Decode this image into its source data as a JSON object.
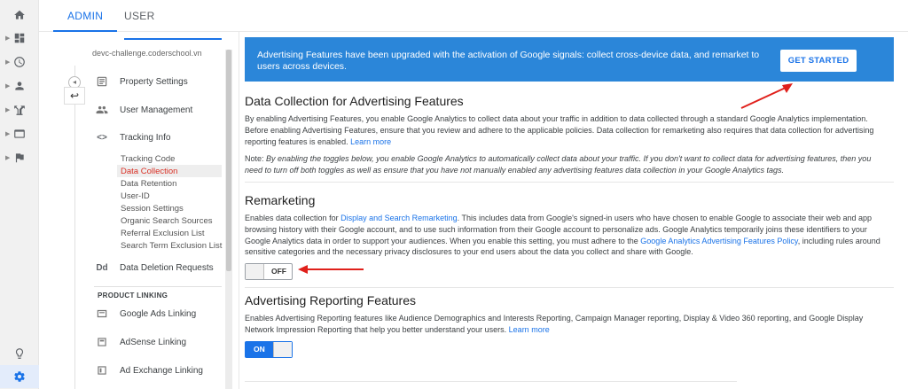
{
  "tabs": {
    "admin": "ADMIN",
    "user": "USER"
  },
  "rail": {
    "items": [
      "home-icon",
      "dashboard-icon",
      "clock-icon",
      "person-icon",
      "acquisition-icon",
      "behavior-icon",
      "flag-icon"
    ],
    "bottom": [
      "lightbulb-icon",
      "gear-icon"
    ]
  },
  "admin": {
    "property": "devc-challenge.coderschool.vn",
    "back_glyph": "↩",
    "collapse_glyph": "◂",
    "nav": {
      "property_settings": "Property Settings",
      "user_management": "User Management",
      "tracking_info": "Tracking Info",
      "tracking_icon_text": "<>",
      "data_deletion": "Data Deletion Requests",
      "data_deletion_icon_text": "Dd"
    },
    "tracking_sub": [
      "Tracking Code",
      "Data Collection",
      "Data Retention",
      "User-ID",
      "Session Settings",
      "Organic Search Sources",
      "Referral Exclusion List",
      "Search Term Exclusion List"
    ],
    "product_linking_label": "PRODUCT LINKING",
    "linking": [
      "Google Ads Linking",
      "AdSense Linking",
      "Ad Exchange Linking"
    ]
  },
  "banner": {
    "text": "Advertising Features have been upgraded with the activation of Google signals: collect cross-device data, and remarket to users across devices.",
    "button": "GET STARTED"
  },
  "data_collection": {
    "title": "Data Collection for Advertising Features",
    "body": "By enabling Advertising Features, you enable Google Analytics to collect data about your traffic in addition to data collected through a standard Google Analytics implementation. Before enabling Advertising Features, ensure that you review and adhere to the applicable policies. Data collection for remarketing also requires that data collection for advertising reporting features is enabled.",
    "learn_more": "Learn more",
    "note_lead": "Note:",
    "note": "By enabling the toggles below, you enable Google Analytics to automatically collect data about your traffic. If you don't want to collect data for advertising features, then you need to turn off both toggles as well as ensure that you have not manually enabled any advertising features data collection in your Google Analytics tags."
  },
  "remarketing": {
    "title": "Remarketing",
    "body_1": "Enables data collection for",
    "link_1": "Display and Search Remarketing",
    "body_2": ". This includes data from Google's signed-in users who have chosen to enable Google to associate their web and app browsing history with their Google account, and to use such information from their Google account to personalize ads. Google Analytics temporarily joins these identifiers to your Google Analytics data in order to support your audiences. When you enable this setting, you must adhere to the",
    "link_2": "Google Analytics Advertising Features Policy",
    "body_3": ", including rules around sensitive categories and the necessary privacy disclosures to your end users about the data you collect and share with Google.",
    "toggle": "OFF"
  },
  "reporting": {
    "title": "Advertising Reporting Features",
    "body": "Enables Advertising Reporting features like Audience Demographics and Interests Reporting, Campaign Manager reporting, Display & Video 360 reporting, and Google Display Network Impression Reporting that help you better understand your users.",
    "learn_more": "Learn more",
    "toggle": "ON"
  },
  "colors": {
    "accent": "#1a73e8",
    "banner": "#2b86d9",
    "annotation": "#e0201b"
  }
}
